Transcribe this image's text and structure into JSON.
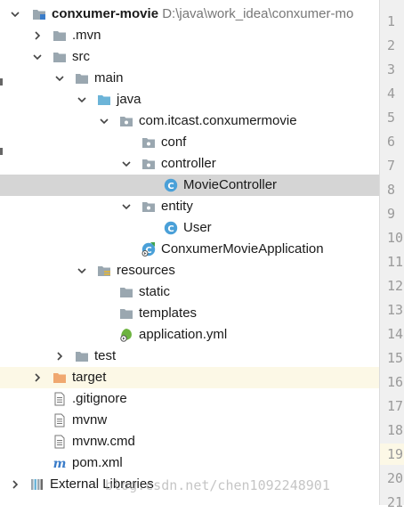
{
  "project": {
    "name": "conxumer-movie",
    "path": "D:\\java\\work_idea\\conxumer-mo"
  },
  "tree": [
    {
      "key": "mvn",
      "label": ".mvn",
      "depth": 1,
      "arrow": "right",
      "icon": "folder-icon"
    },
    {
      "key": "src",
      "label": "src",
      "depth": 1,
      "arrow": "down",
      "icon": "folder-icon"
    },
    {
      "key": "main",
      "label": "main",
      "depth": 2,
      "arrow": "down",
      "icon": "folder-icon"
    },
    {
      "key": "java",
      "label": "java",
      "depth": 3,
      "arrow": "down",
      "icon": "source-folder-icon"
    },
    {
      "key": "pkg",
      "label": "com.itcast.conxumermovie",
      "depth": 4,
      "arrow": "down",
      "icon": "package-icon"
    },
    {
      "key": "conf",
      "label": "conf",
      "depth": 5,
      "arrow": "none",
      "icon": "package-icon"
    },
    {
      "key": "controller",
      "label": "controller",
      "depth": 5,
      "arrow": "down",
      "icon": "package-icon"
    },
    {
      "key": "moviecontroller",
      "label": "MovieController",
      "depth": 6,
      "arrow": "none",
      "icon": "class-icon",
      "selected": true
    },
    {
      "key": "entity",
      "label": "entity",
      "depth": 5,
      "arrow": "down",
      "icon": "package-icon"
    },
    {
      "key": "user",
      "label": "User",
      "depth": 6,
      "arrow": "none",
      "icon": "class-icon"
    },
    {
      "key": "app",
      "label": "ConxumerMovieApplication",
      "depth": 5,
      "arrow": "none",
      "icon": "spring-class-icon"
    },
    {
      "key": "resources",
      "label": "resources",
      "depth": 3,
      "arrow": "down",
      "icon": "resources-folder-icon"
    },
    {
      "key": "static",
      "label": "static",
      "depth": 4,
      "arrow": "none",
      "icon": "folder-icon"
    },
    {
      "key": "templates",
      "label": "templates",
      "depth": 4,
      "arrow": "none",
      "icon": "folder-icon"
    },
    {
      "key": "appyml",
      "label": "application.yml",
      "depth": 4,
      "arrow": "none",
      "icon": "spring-config-icon"
    },
    {
      "key": "test",
      "label": "test",
      "depth": 2,
      "arrow": "right",
      "icon": "folder-icon"
    },
    {
      "key": "target",
      "label": "target",
      "depth": 1,
      "arrow": "right",
      "icon": "excluded-folder-icon",
      "highlighted": true
    },
    {
      "key": "gitignore",
      "label": ".gitignore",
      "depth": 1,
      "arrow": "none",
      "icon": "text-file-icon"
    },
    {
      "key": "mvnw",
      "label": "mvnw",
      "depth": 1,
      "arrow": "none",
      "icon": "text-file-icon"
    },
    {
      "key": "mvnwcmd",
      "label": "mvnw.cmd",
      "depth": 1,
      "arrow": "none",
      "icon": "text-file-icon"
    },
    {
      "key": "pom",
      "label": "pom.xml",
      "depth": 1,
      "arrow": "none",
      "icon": "maven-icon"
    },
    {
      "key": "extlib",
      "label": "External Libraries",
      "depth": 0,
      "arrow": "right",
      "icon": "libraries-icon"
    }
  ],
  "gutter_lines": [
    "1",
    "2",
    "3",
    "4",
    "5",
    "6",
    "7",
    "8",
    "9",
    "10",
    "11",
    "12",
    "13",
    "14",
    "15",
    "16",
    "17",
    "18",
    "19",
    "20",
    "21"
  ],
  "current_line": "19",
  "watermark": "blog.csdn.net/chen1092248901",
  "colors": {
    "folder": "#9aa7b0",
    "source_folder": "#6cb4d8",
    "excluded_folder": "#f0a870",
    "class": "#4aa0d8",
    "selected_row": "#d5d5d5",
    "highlight_row": "#fcf8e6"
  }
}
